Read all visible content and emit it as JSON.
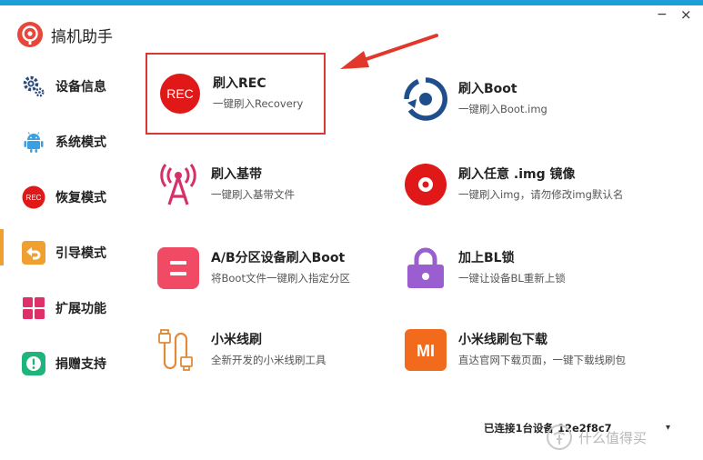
{
  "window": {
    "minimize_glyph": "−",
    "close_glyph": "×"
  },
  "app": {
    "title": "搞机助手",
    "logo_icon": "app-logo-icon"
  },
  "colors": {
    "accent_bar": "#1a9fd8",
    "active_indicator": "#f0a030",
    "highlight_border": "#d93636",
    "arrow": "#e2382b"
  },
  "sidebar": {
    "items": [
      {
        "label": "设备信息",
        "icon": "gears-icon",
        "active": false
      },
      {
        "label": "系统模式",
        "icon": "android-icon",
        "active": false
      },
      {
        "label": "恢复模式",
        "icon": "rec-icon",
        "icon_text": "REC",
        "active": false
      },
      {
        "label": "引导模式",
        "icon": "back-arrow-icon",
        "active": true
      },
      {
        "label": "扩展功能",
        "icon": "grid-icon",
        "active": false
      },
      {
        "label": "捐赠支持",
        "icon": "alert-icon",
        "active": false
      }
    ]
  },
  "cards": [
    {
      "title": "刷入REC",
      "desc": "一键刷入Recovery",
      "icon": "rec-icon",
      "icon_text": "REC",
      "highlighted": true
    },
    {
      "title": "刷入Boot",
      "desc": "一键刷入Boot.img",
      "icon": "boot-icon",
      "highlighted": false
    },
    {
      "title": "刷入基带",
      "desc": "一键刷入基带文件",
      "icon": "antenna-icon",
      "highlighted": false
    },
    {
      "title": "刷入任意 .img 镜像",
      "desc": "一键刷入img，请勿修改img默认名",
      "icon": "disc-icon",
      "highlighted": false
    },
    {
      "title": "A/B分区设备刷入Boot",
      "desc": "将Boot文件一键刷入指定分区",
      "icon": "partition-icon",
      "highlighted": false
    },
    {
      "title": "加上BL锁",
      "desc": "一键让设备BL重新上锁",
      "icon": "lock-icon",
      "highlighted": false
    },
    {
      "title": "小米线刷",
      "desc": "全新开发的小米线刷工具",
      "icon": "usb-cable-icon",
      "highlighted": false
    },
    {
      "title": "小米线刷包下载",
      "desc": "直达官网下载页面，一键下载线刷包",
      "icon": "mi-logo-icon",
      "icon_text": "MI",
      "highlighted": false
    }
  ],
  "status": {
    "text": "已连接1台设备  12e2f8c7",
    "dropdown_glyph": "▾"
  },
  "watermark": {
    "text": "什么值得买",
    "icon": "watermark-icon"
  }
}
